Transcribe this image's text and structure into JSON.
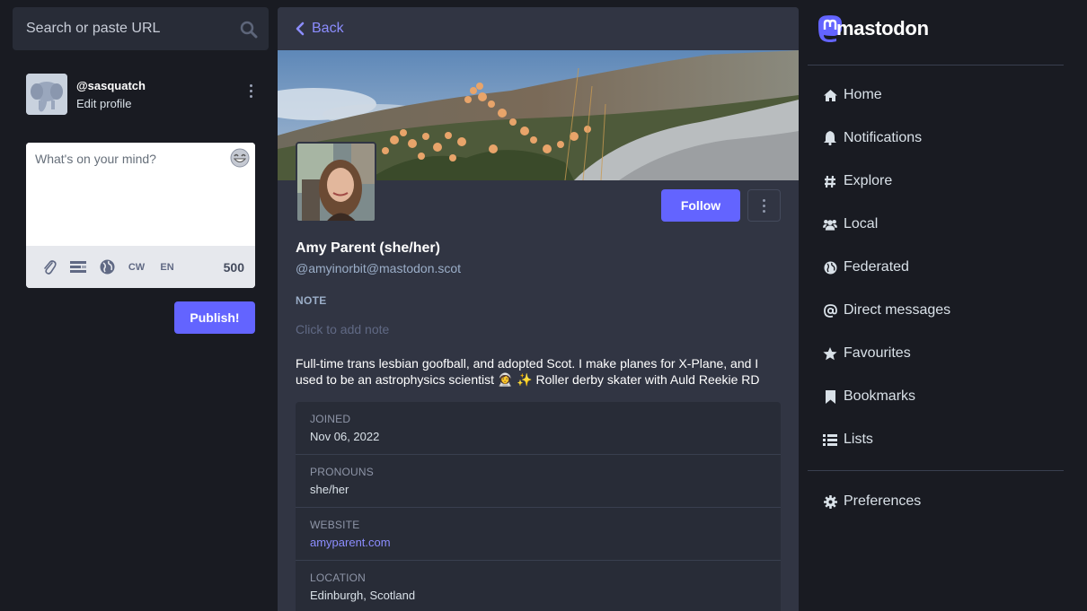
{
  "search": {
    "placeholder": "Search or paste URL"
  },
  "account": {
    "handle": "@sasquatch",
    "edit_label": "Edit profile"
  },
  "compose": {
    "placeholder": "What's on your mind?",
    "cw_label": "CW",
    "lang_label": "EN",
    "char_count": "500",
    "publish_label": "Publish!"
  },
  "profile": {
    "back_label": "Back",
    "follow_label": "Follow",
    "display_name": "Amy Parent (she/her)",
    "handle": "@amyinorbit@mastodon.scot",
    "note_label": "NOTE",
    "note_placeholder": "Click to add note",
    "bio": "Full-time trans lesbian goofball, and adopted Scot. I make planes for X-Plane, and I used to be an astrophysics scientist 👩‍🚀 ✨ Roller derby skater with Auld Reekie RD",
    "fields": [
      {
        "name": "JOINED",
        "value": "Nov 06, 2022",
        "link": false
      },
      {
        "name": "PRONOUNS",
        "value": "she/her",
        "link": false
      },
      {
        "name": "WEBSITE",
        "value": "amyparent.com",
        "link": true
      },
      {
        "name": "LOCATION",
        "value": "Edinburgh, Scotland",
        "link": false
      }
    ]
  },
  "brand": {
    "name": "mastodon",
    "accent": "#6364ff"
  },
  "nav": {
    "items": [
      {
        "label": "Home",
        "icon": "home-icon"
      },
      {
        "label": "Notifications",
        "icon": "bell-icon"
      },
      {
        "label": "Explore",
        "icon": "hashtag-icon"
      },
      {
        "label": "Local",
        "icon": "users-icon"
      },
      {
        "label": "Federated",
        "icon": "globe-icon"
      },
      {
        "label": "Direct messages",
        "icon": "at-icon"
      },
      {
        "label": "Favourites",
        "icon": "star-icon"
      },
      {
        "label": "Bookmarks",
        "icon": "bookmark-icon"
      },
      {
        "label": "Lists",
        "icon": "list-icon"
      }
    ],
    "preferences_label": "Preferences"
  }
}
